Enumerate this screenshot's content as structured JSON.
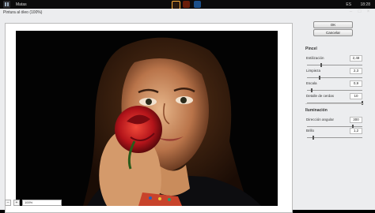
{
  "taskbar": {
    "app_title": "Matas",
    "language": "ES",
    "clock": "18:28"
  },
  "dialog": {
    "title": "Pintura al óleo (100%)",
    "ok_label": "OK",
    "cancel_label": "Cancelar",
    "zoom_out": "–",
    "zoom_in": "+",
    "zoom_value": "100%"
  },
  "sections": {
    "brush_title": "Pincel",
    "light_title": "Iluminación"
  },
  "brush_params": [
    {
      "label": "Estilización",
      "value": "2,48",
      "level": 0.25
    },
    {
      "label": "Limpieza",
      "value": "2,3",
      "level": 0.23
    },
    {
      "label": "Escala",
      "value": "0,9",
      "level": 0.08
    },
    {
      "label": "Detalle de cerdas",
      "value": "10",
      "level": 1.0
    }
  ],
  "light_params": [
    {
      "label": "Dirección angular",
      "value": "300",
      "level": 0.83
    },
    {
      "label": "Brillo",
      "value": "1,2",
      "level": 0.12
    }
  ]
}
